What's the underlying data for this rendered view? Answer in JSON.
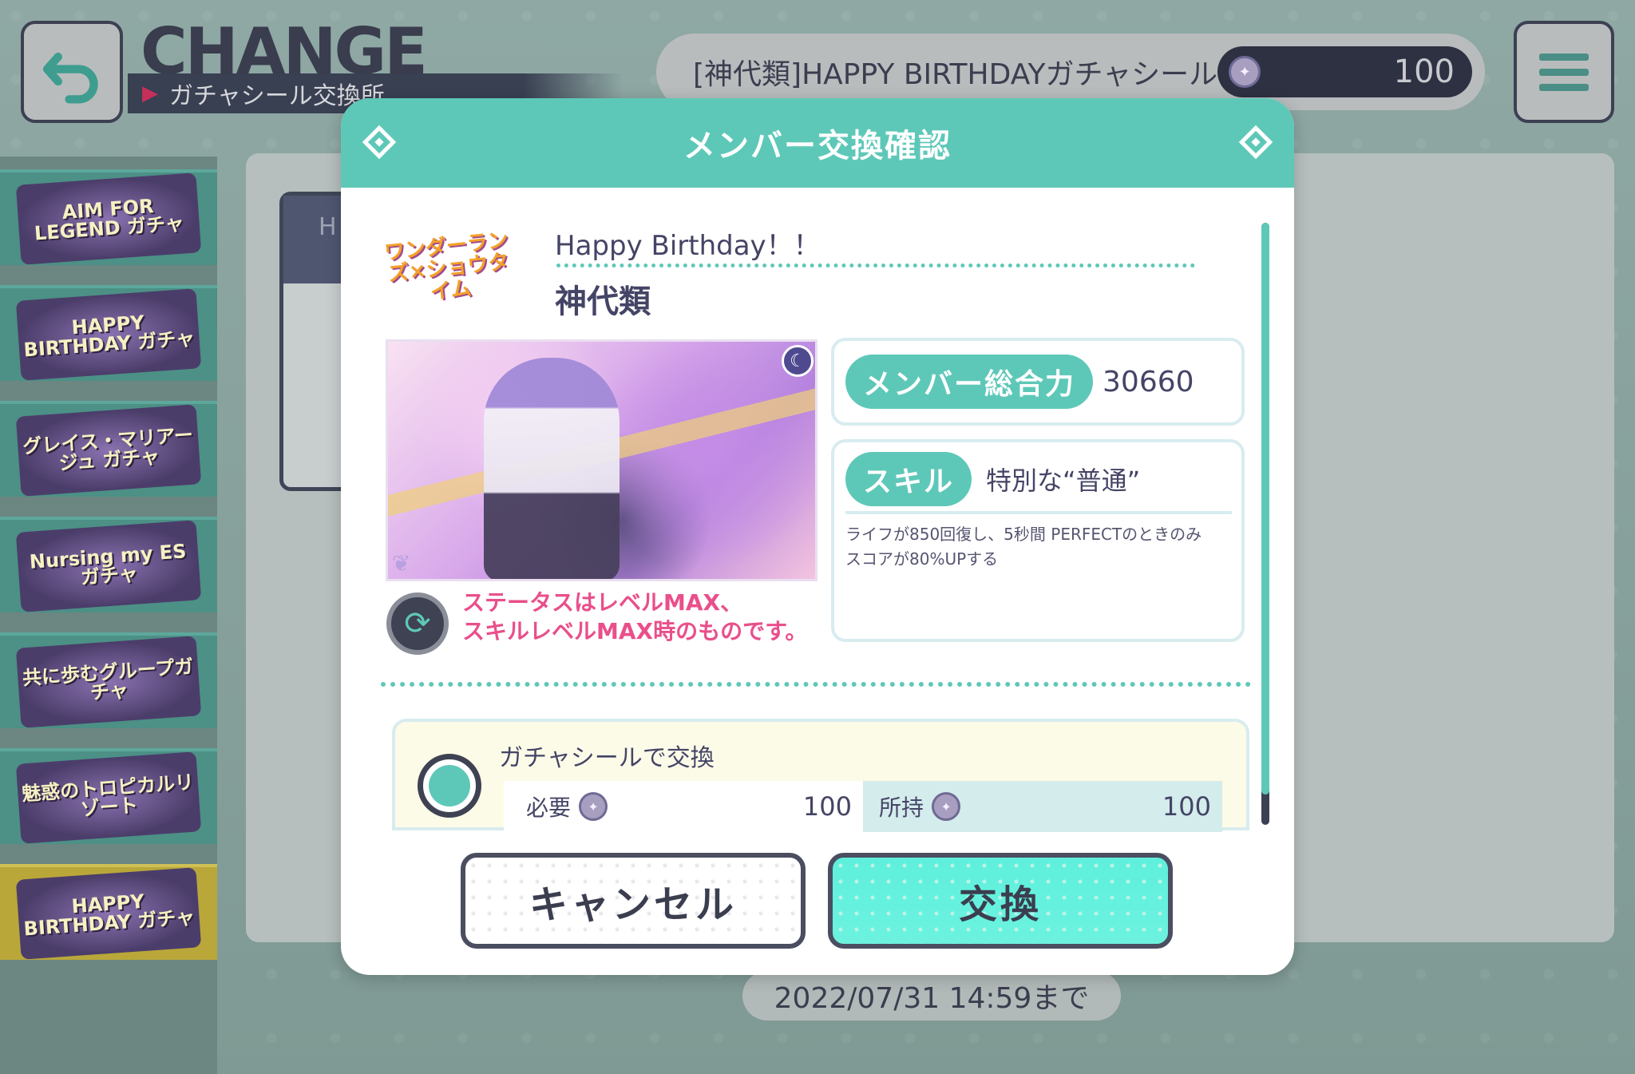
{
  "header": {
    "title": "CHANGE",
    "subtitle": "ガチャシール交換所",
    "gacha_seal_label": "[神代類]HAPPY BIRTHDAYガチャシール",
    "gacha_seal_count": "100"
  },
  "sidebar": {
    "banners": [
      {
        "label": "AIM FOR LEGEND ガチャ"
      },
      {
        "label": "HAPPY BIRTHDAY ガチャ"
      },
      {
        "label": "グレイス・マリアージュ ガチャ"
      },
      {
        "label": "Nursing my ES ガチャ"
      },
      {
        "label": "共に歩むグループガチャ"
      },
      {
        "label": "魅惑のトロピカルリゾート"
      },
      {
        "label": "HAPPY BIRTHDAY ガチャ",
        "selected": true
      }
    ]
  },
  "background": {
    "card_initial": "H",
    "deadline": "2022/07/31 14:59まで"
  },
  "dialog": {
    "title": "メンバー交換確認",
    "unit_logo_text": "ワンダーランズ×ショウタイム",
    "card_title": "Happy Birthday！！",
    "character_name": "神代類",
    "status_note": "ステータスはレベルMAX、\nスキルレベルMAX時のものです。",
    "power": {
      "label": "メンバー総合力",
      "value": "30660"
    },
    "skill": {
      "label": "スキル",
      "name": "特別な“普通”",
      "description": "ライフが850回復し、5秒間 PERFECTのときのみ\nスコアが80%UPする"
    },
    "exchange": {
      "title": "ガチャシールで交換",
      "need_label": "必要",
      "need_value": "100",
      "have_label": "所持",
      "have_value": "100"
    },
    "cancel_label": "キャンセル",
    "confirm_label": "交換"
  },
  "colors": {
    "accent": "#5ec8b8",
    "note_pink": "#e94f8b",
    "dark": "#3e4252"
  }
}
